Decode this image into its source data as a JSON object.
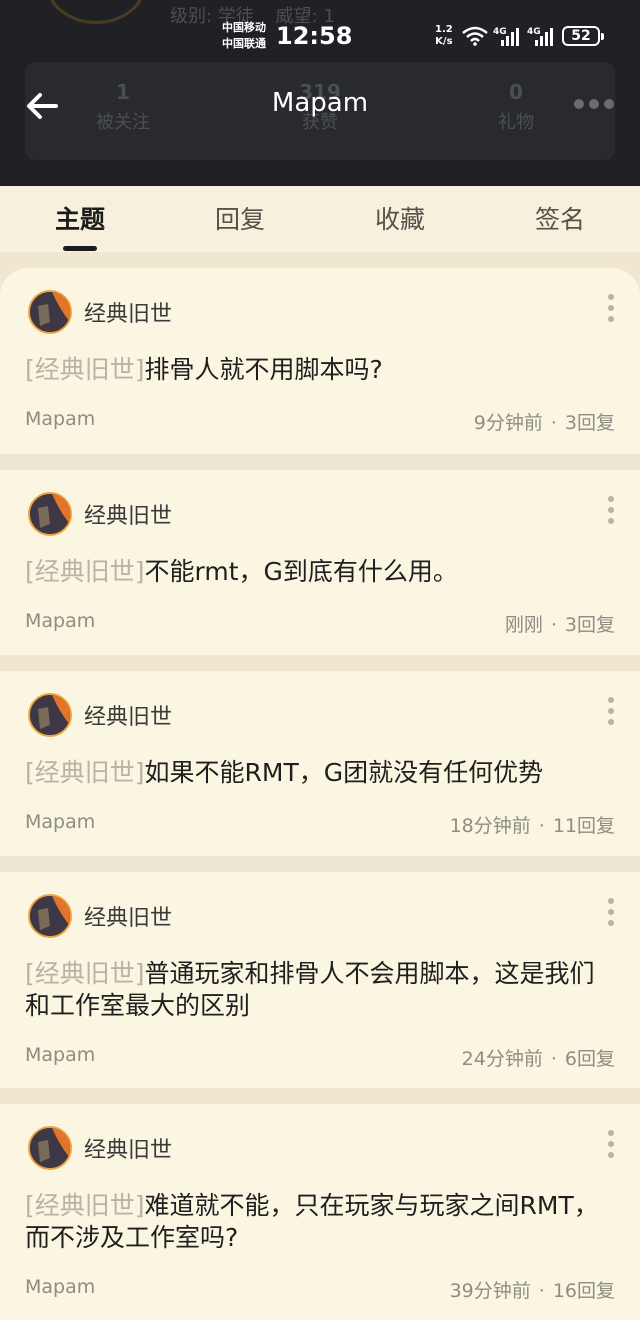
{
  "status_bar": {
    "carrier_1": "中国移动",
    "carrier_2": "中国联通",
    "time": "12:58",
    "net_speed_value": "1.2",
    "net_speed_unit": "K/s",
    "sim1_label": "4G",
    "sim2_label": "4G",
    "battery": "52"
  },
  "profile_background": {
    "level_label": "级别: 学徒",
    "prestige_label": "威望: 1",
    "stats": [
      {
        "value": "1",
        "label": "被关注"
      },
      {
        "value": "319",
        "label": "获赞"
      },
      {
        "value": "0",
        "label": "礼物"
      }
    ]
  },
  "navbar": {
    "title": "Mapam"
  },
  "tabs": [
    {
      "label": "主题",
      "active": true
    },
    {
      "label": "回复",
      "active": false
    },
    {
      "label": "收藏",
      "active": false
    },
    {
      "label": "签名",
      "active": false
    }
  ],
  "posts": [
    {
      "forum": "经典旧世",
      "tag": "[经典旧世]",
      "title": "排骨人就不用脚本吗?",
      "author": "Mapam",
      "time": "9分钟前",
      "replies": "3回复"
    },
    {
      "forum": "经典旧世",
      "tag": "[经典旧世]",
      "title": "不能rmt，G到底有什么用。",
      "author": "Mapam",
      "time": "刚刚",
      "replies": "3回复"
    },
    {
      "forum": "经典旧世",
      "tag": "[经典旧世]",
      "title": "如果不能RMT，G团就没有任何优势",
      "author": "Mapam",
      "time": "18分钟前",
      "replies": "11回复"
    },
    {
      "forum": "经典旧世",
      "tag": "[经典旧世]",
      "title": "普通玩家和排骨人不会用脚本，这是我们和工作室最大的区别",
      "author": "Mapam",
      "time": "24分钟前",
      "replies": "6回复"
    },
    {
      "forum": "经典旧世",
      "tag": "[经典旧世]",
      "title": "难道就不能，只在玩家与玩家之间RMT，而不涉及工作室吗?",
      "author": "Mapam",
      "time": "39分钟前",
      "replies": "16回复"
    }
  ],
  "meta_separator": "·",
  "colors": {
    "header_bg": "#202125",
    "page_bg": "#f7f0dc",
    "card_bg": "#fbf6e2",
    "tag_gray": "#b8b3a6",
    "avatar_ring": "#f0a53c"
  }
}
